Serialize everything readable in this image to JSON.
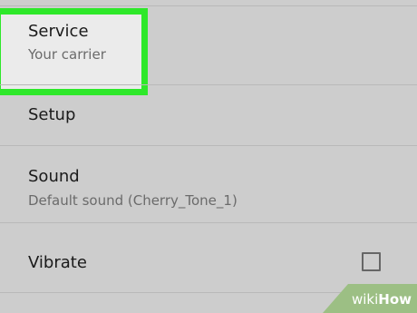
{
  "settings": {
    "items": [
      {
        "id": "service",
        "title": "Service",
        "subtitle": "Your carrier",
        "highlighted": true,
        "highlight_color": "#2ee82a"
      },
      {
        "id": "setup",
        "title": "Setup"
      },
      {
        "id": "sound",
        "title": "Sound",
        "subtitle": "Default sound (Cherry_Tone_1)"
      },
      {
        "id": "vibrate",
        "title": "Vibrate",
        "checkbox_checked": false
      }
    ]
  },
  "watermark": {
    "part1": "wiki",
    "part2": "How"
  },
  "colors": {
    "background": "#cdcdcd",
    "highlight_border": "#2ee82a",
    "watermark": "#9cbf84"
  }
}
